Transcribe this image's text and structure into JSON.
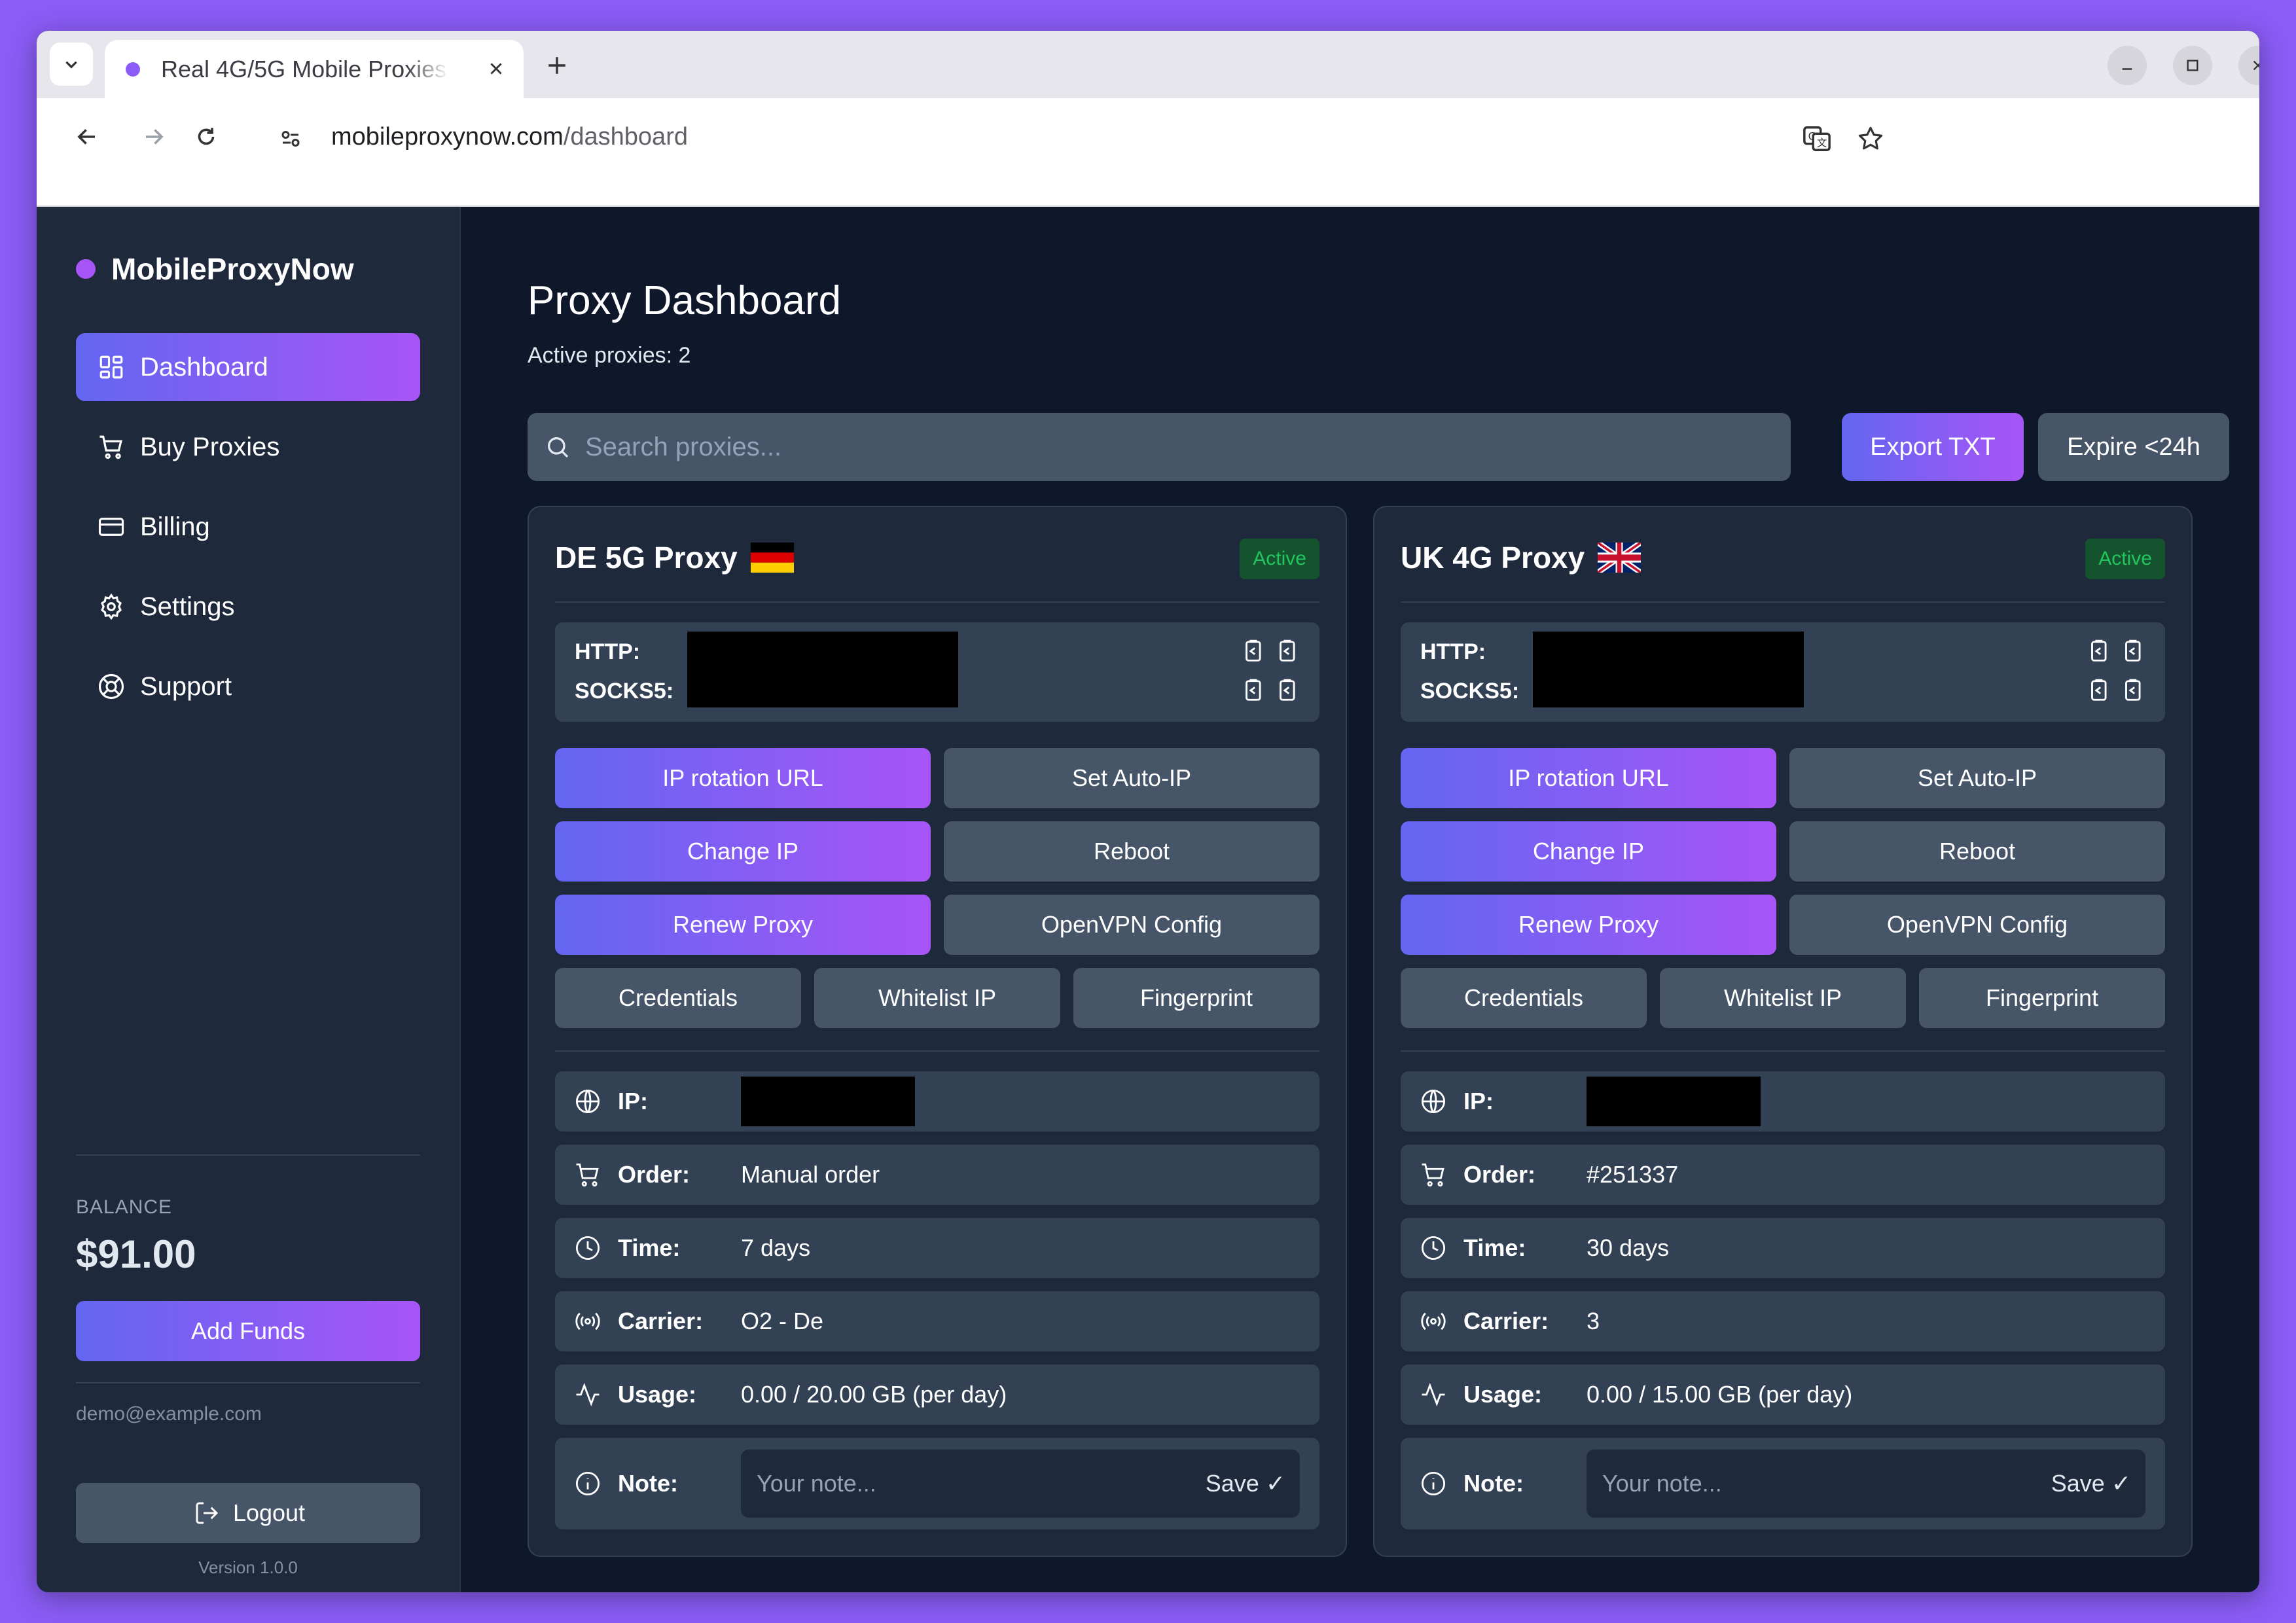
{
  "browser": {
    "tab_title": "Real 4G/5G Mobile Proxies",
    "url_host": "mobileproxynow.com",
    "url_path": "/dashboard"
  },
  "sidebar": {
    "brand": "MobileProxyNow",
    "items": [
      {
        "label": "Dashboard",
        "icon": "dashboard-icon",
        "active": true
      },
      {
        "label": "Buy Proxies",
        "icon": "cart-icon",
        "active": false
      },
      {
        "label": "Billing",
        "icon": "credit-card-icon",
        "active": false
      },
      {
        "label": "Settings",
        "icon": "gear-icon",
        "active": false
      },
      {
        "label": "Support",
        "icon": "lifebuoy-icon",
        "active": false
      }
    ],
    "balance_label": "BALANCE",
    "balance_value": "$91.00",
    "add_funds": "Add Funds",
    "email": "demo@example.com",
    "logout": "Logout",
    "version": "Version 1.0.0"
  },
  "main": {
    "title": "Proxy Dashboard",
    "subtitle": "Active proxies: 2",
    "search_placeholder": "Search proxies...",
    "export_btn": "Export TXT",
    "expire_btn": "Expire <24h"
  },
  "cards": [
    {
      "title": "DE 5G Proxy",
      "flag": "de-flag-icon",
      "status": "Active",
      "http_label": "HTTP:",
      "socks_label": "SOCKS5:",
      "buttons": {
        "ip_rotation": "IP rotation URL",
        "auto_ip": "Set Auto-IP",
        "change_ip": "Change IP",
        "reboot": "Reboot",
        "renew": "Renew Proxy",
        "openvpn": "OpenVPN Config",
        "credentials": "Credentials",
        "whitelist": "Whitelist IP",
        "fingerprint": "Fingerprint"
      },
      "ip_label": "IP:",
      "order_label": "Order:",
      "order_value": "Manual order",
      "time_label": "Time:",
      "time_value": "7 days",
      "carrier_label": "Carrier:",
      "carrier_value": "O2 - De",
      "usage_label": "Usage:",
      "usage_value": "0.00 / 20.00 GB (per day)",
      "note_label": "Note:",
      "note_placeholder": "Your note...",
      "note_save": "Save ✓"
    },
    {
      "title": "UK 4G Proxy",
      "flag": "uk-flag-icon",
      "status": "Active",
      "http_label": "HTTP:",
      "socks_label": "SOCKS5:",
      "buttons": {
        "ip_rotation": "IP rotation URL",
        "auto_ip": "Set Auto-IP",
        "change_ip": "Change IP",
        "reboot": "Reboot",
        "renew": "Renew Proxy",
        "openvpn": "OpenVPN Config",
        "credentials": "Credentials",
        "whitelist": "Whitelist IP",
        "fingerprint": "Fingerprint"
      },
      "ip_label": "IP:",
      "order_label": "Order:",
      "order_value": "#251337",
      "time_label": "Time:",
      "time_value": "30 days",
      "carrier_label": "Carrier:",
      "carrier_value": "3",
      "usage_label": "Usage:",
      "usage_value": "0.00 / 15.00 GB (per day)",
      "note_label": "Note:",
      "note_placeholder": "Your note...",
      "note_save": "Save ✓"
    }
  ],
  "colors": {
    "accent_start": "#6366f1",
    "accent_end": "#a855f7",
    "page_bg": "#0f172a",
    "sidebar_bg": "#1e293b",
    "status_green": "#22c55e",
    "desktop_bg": "#8b5cf6"
  }
}
